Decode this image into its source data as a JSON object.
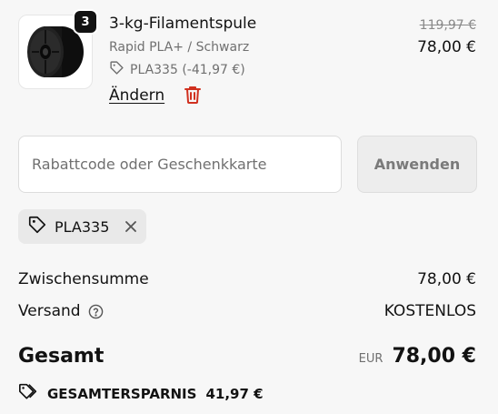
{
  "product": {
    "quantity": "3",
    "title": "3-kg-Filamentspule",
    "variant": "Rapid PLA+ / Schwarz",
    "discount_code": "PLA335 (-41,97 €)",
    "change_label": "Ändern",
    "price_original": "119,97 €",
    "price_final": "78,00 €"
  },
  "discount": {
    "placeholder": "Rabattcode oder Geschenkkarte",
    "apply_label": "Anwenden",
    "applied_code": "PLA335"
  },
  "summary": {
    "subtotal_label": "Zwischensumme",
    "subtotal_value": "78,00 €",
    "shipping_label": "Versand",
    "shipping_value": "KOSTENLOS",
    "total_label": "Gesamt",
    "total_currency": "EUR",
    "total_value": "78,00 €",
    "savings_label": "GESAMTERSPARNIS",
    "savings_value": "41,97 €"
  },
  "colors": {
    "background": "#f7f7f7",
    "text": "#121212",
    "muted": "#707070",
    "delete_red": "#d0301f",
    "badge": "#121212"
  },
  "icons": [
    "spool-image",
    "tag-icon",
    "trash-icon",
    "close-icon",
    "help-circle-icon",
    "tags-icon"
  ]
}
